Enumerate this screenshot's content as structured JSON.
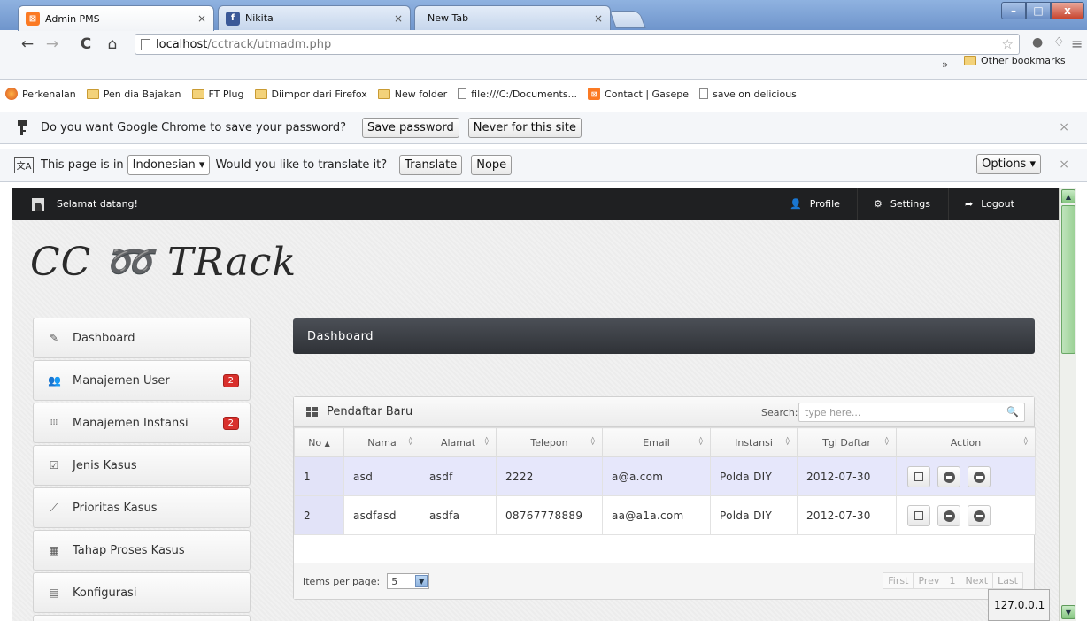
{
  "browser": {
    "tabs": [
      {
        "label": "Admin PMS",
        "active": true,
        "favicon": "xampp-icon",
        "color": "#fb7a24"
      },
      {
        "label": "Nikita",
        "active": false,
        "favicon": "facebook-icon",
        "color": "#3b5998"
      },
      {
        "label": "New Tab",
        "active": false,
        "favicon": "",
        "color": ""
      }
    ],
    "close_glyph": "×",
    "address": {
      "host": "localhost",
      "path": "/cctrack/utmadm.php"
    },
    "bookmarks": [
      {
        "label": "Perkenalan",
        "icon": "firefox-icon"
      },
      {
        "label": "Pen dia Bajakan",
        "icon": "folder-icon"
      },
      {
        "label": "FT Plug",
        "icon": "folder-icon"
      },
      {
        "label": "Diimpor dari Firefox",
        "icon": "folder-icon"
      },
      {
        "label": "New folder",
        "icon": "folder-icon"
      },
      {
        "label": "file:///C:/Documents...",
        "icon": "page-icon"
      },
      {
        "label": "Contact | Gasepe",
        "icon": "xampp-icon"
      },
      {
        "label": "save on delicious",
        "icon": "page-icon"
      }
    ],
    "bookmarks_overflow": "»",
    "other_bookmarks": "Other bookmarks",
    "password_bar": {
      "message": "Do you want Google Chrome to save your password?",
      "save_label": "Save password",
      "never_label": "Never for this site"
    },
    "translate_bar": {
      "prefix": "This page is in",
      "language": "Indonesian ▾",
      "question": "Would you like to translate it?",
      "translate_label": "Translate",
      "nope_label": "Nope",
      "options_label": "Options ▾"
    },
    "status_url": "127.0.0.1"
  },
  "app": {
    "welcome": "Selamat datang!",
    "nav": [
      {
        "label": "Profile",
        "glyph": "👤"
      },
      {
        "label": "Settings",
        "glyph": "⚙"
      },
      {
        "label": "Logout",
        "glyph": "➦"
      }
    ],
    "logo": "CC ➿ TRack",
    "sidebar": [
      {
        "label": "Dashboard",
        "glyph": "✎",
        "icon": "pencil-icon",
        "badge": ""
      },
      {
        "label": "Manajemen User",
        "glyph": "👥",
        "icon": "users-icon",
        "badge": "2"
      },
      {
        "label": "Manajemen Instansi",
        "glyph": "⁞⁞⁞",
        "icon": "grid-icon",
        "badge": "2"
      },
      {
        "label": "Jenis Kasus",
        "glyph": "☑",
        "icon": "edit-icon",
        "badge": ""
      },
      {
        "label": "Prioritas Kasus",
        "glyph": "⟋",
        "icon": "chart-icon",
        "badge": ""
      },
      {
        "label": "Tahap Proses Kasus",
        "glyph": "▦",
        "icon": "blocks-icon",
        "badge": ""
      },
      {
        "label": "Konfigurasi",
        "glyph": "▤",
        "icon": "config-icon",
        "badge": ""
      }
    ],
    "page_header": "Dashboard",
    "widget": {
      "title": "Pendaftar Baru",
      "search_label": "Search:",
      "search_placeholder": "type here...",
      "columns": [
        "No",
        "Nama",
        "Alamat",
        "Telepon",
        "Email",
        "Instansi",
        "Tgl Daftar",
        "Action"
      ],
      "rows": [
        {
          "no": "1",
          "nama": "asd",
          "alamat": "asdf",
          "telepon": "2222",
          "email": "a@a.com",
          "instansi": "Polda DIY",
          "tgl": "2012-07-30"
        },
        {
          "no": "2",
          "nama": "asdfasd",
          "alamat": "asdfa",
          "telepon": "08767778889",
          "email": "aa@a1a.com",
          "instansi": "Polda DIY",
          "tgl": "2012-07-30"
        }
      ],
      "items_per_page_label": "Items per page:",
      "items_per_page_value": "5",
      "pager": [
        "First",
        "Prev",
        "1",
        "Next",
        "Last"
      ]
    }
  }
}
